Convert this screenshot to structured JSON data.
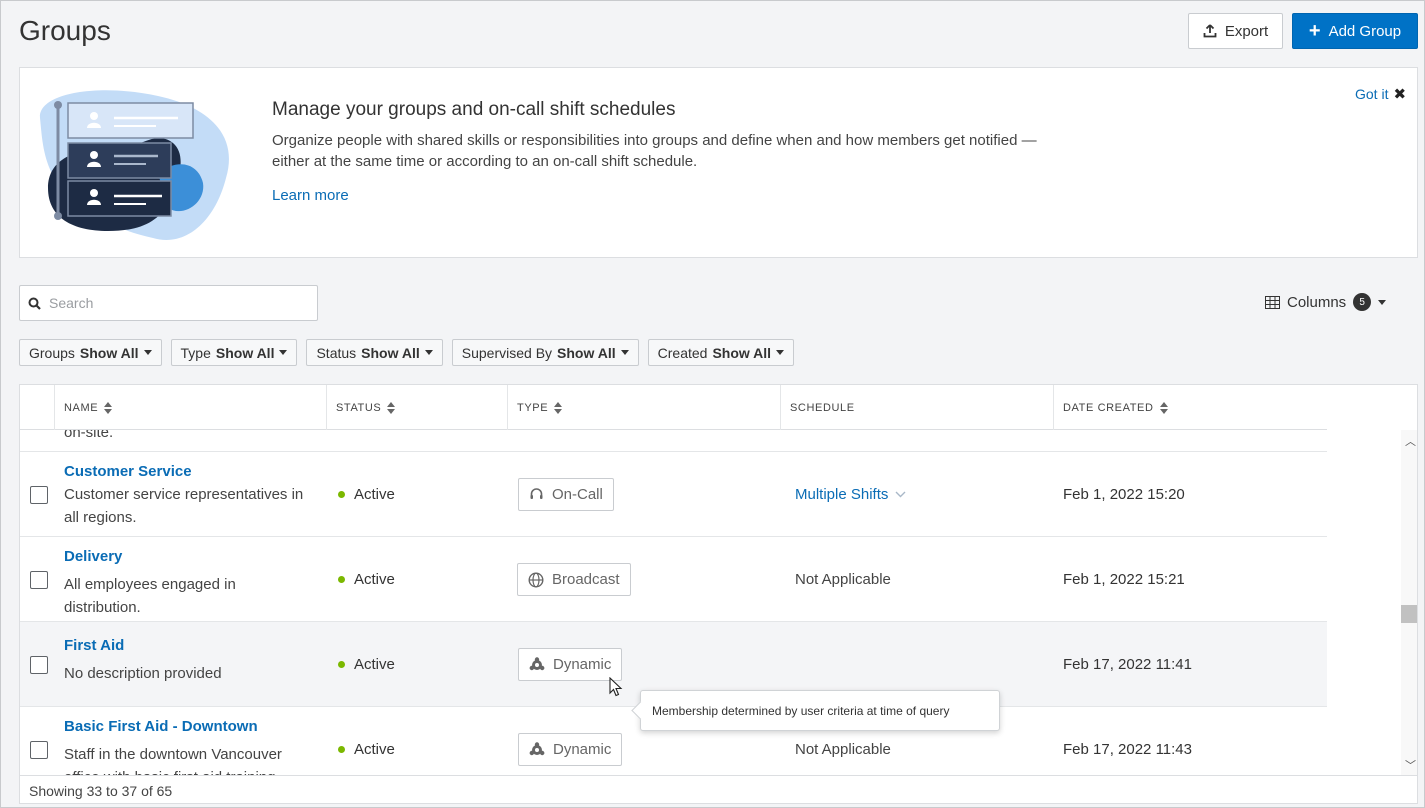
{
  "page": {
    "title": "Groups",
    "export_label": "Export",
    "add_label": "Add Group"
  },
  "banner": {
    "title": "Manage your groups and on-call shift schedules",
    "description": "Organize people with shared skills or responsibilities into groups and define when and how members get notified — either at the same time or according to an on-call shift schedule.",
    "learn_more": "Learn more",
    "dismiss": "Got it"
  },
  "search": {
    "placeholder": "Search"
  },
  "columns": {
    "label": "Columns",
    "count": "5"
  },
  "filters": [
    {
      "label": "Groups",
      "value": "Show All"
    },
    {
      "label": "Type",
      "value": "Show All"
    },
    {
      "label": "Status",
      "value": "Show All"
    },
    {
      "label": "Supervised By",
      "value": "Show All"
    },
    {
      "label": "Created",
      "value": "Show All"
    }
  ],
  "table": {
    "headers": [
      "NAME",
      "STATUS",
      "TYPE",
      "SCHEDULE",
      "DATE CREATED"
    ],
    "partial_text": "on-site.",
    "rows": [
      {
        "name": "Customer Service",
        "desc": "Customer service representatives in all regions.",
        "status": "Active",
        "type": "On-Call",
        "schedule": "Multiple Shifts",
        "date": "Feb 1, 2022 15:20"
      },
      {
        "name": "Delivery",
        "desc": "All employees engaged in distribution.",
        "status": "Active",
        "type": "Broadcast",
        "schedule": "Not Applicable",
        "date": "Feb 1, 2022 15:21"
      },
      {
        "name": "First Aid",
        "desc": "No description provided",
        "status": "Active",
        "type": "Dynamic",
        "schedule": "",
        "date": "Feb 17, 2022 11:41"
      },
      {
        "name": "Basic First Aid - Downtown",
        "desc": "Staff in the downtown Vancouver office with basic first aid training",
        "status": "Active",
        "type": "Dynamic",
        "schedule": "Not Applicable",
        "date": "Feb 17, 2022 11:43"
      }
    ],
    "tooltip": "Membership determined by user criteria at time of query",
    "footer": "Showing 33 to 37 of 65"
  },
  "colors": {
    "accent": "#0072c6",
    "link": "#0a6cb5",
    "active_dot": "#7bb800"
  }
}
